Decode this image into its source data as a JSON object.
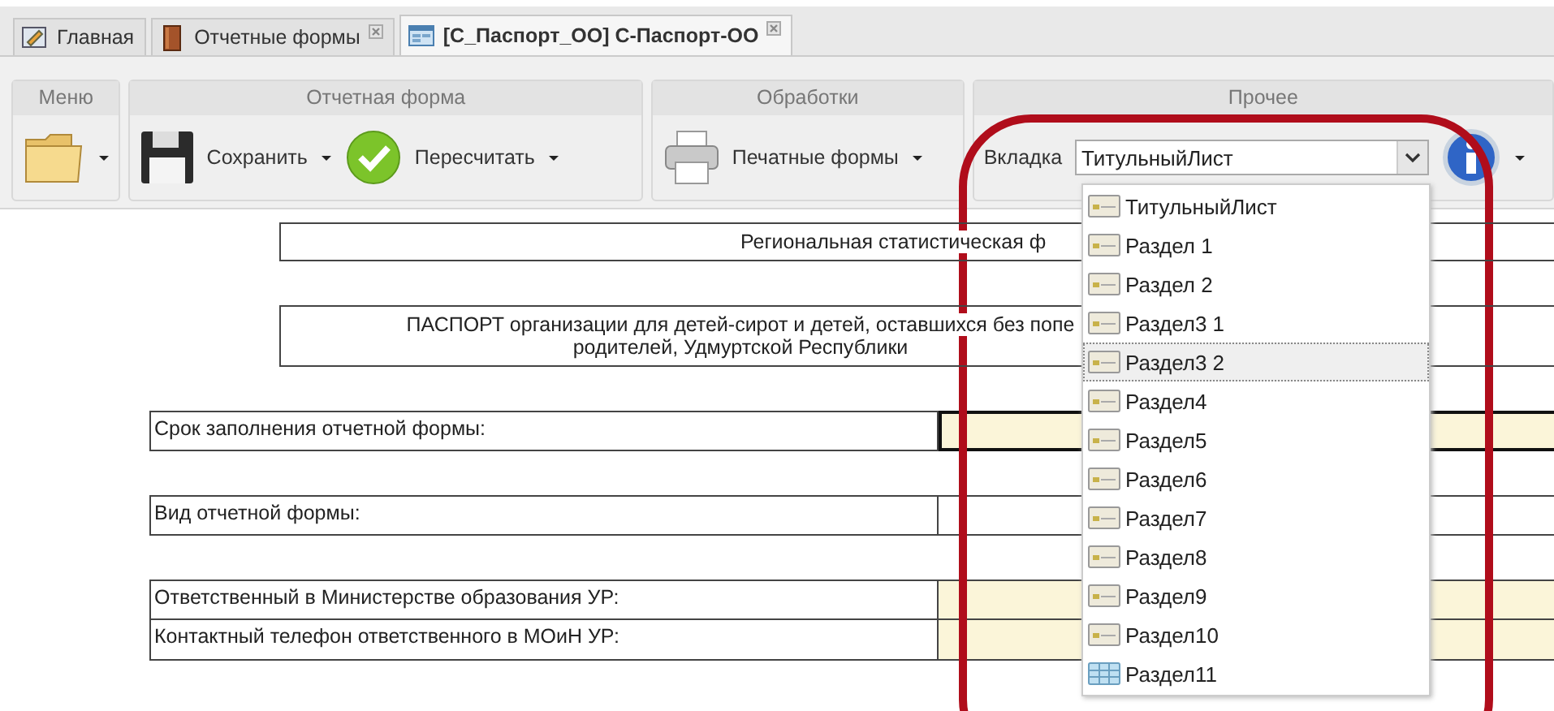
{
  "tabs": [
    {
      "label": "Главная",
      "kind": "home",
      "closable": false,
      "selected": false
    },
    {
      "label": "Отчетные формы",
      "kind": "forms",
      "closable": true,
      "selected": false
    },
    {
      "label": "[С_Паспорт_ОО] С-Паспорт-ОО",
      "kind": "document",
      "closable": true,
      "selected": true
    }
  ],
  "toolbar": [
    {
      "title": "Меню",
      "items": [
        {
          "kind": "folder"
        }
      ]
    },
    {
      "title": "Отчетная форма",
      "items": [
        {
          "kind": "save",
          "label": "Сохранить"
        },
        {
          "kind": "recalc",
          "label": "Пересчитать"
        }
      ]
    },
    {
      "title": "Обработки",
      "items": [
        {
          "kind": "print",
          "label": "Печатные формы"
        }
      ]
    },
    {
      "title": "Прочее",
      "items": [
        {
          "kind": "combo",
          "label": "Вкладка",
          "value": "ТитульныйЛист"
        },
        {
          "kind": "info"
        }
      ]
    }
  ],
  "dropdown": [
    {
      "label": "ТитульныйЛист",
      "kind": "sheet",
      "selected": false
    },
    {
      "label": "Раздел 1",
      "kind": "sheet",
      "selected": false
    },
    {
      "label": "Раздел 2",
      "kind": "sheet",
      "selected": false
    },
    {
      "label": "Раздел3 1",
      "kind": "sheet",
      "selected": false
    },
    {
      "label": "Раздел3 2",
      "kind": "sheet",
      "selected": true
    },
    {
      "label": "Раздел4",
      "kind": "sheet",
      "selected": false
    },
    {
      "label": "Раздел5",
      "kind": "sheet",
      "selected": false
    },
    {
      "label": "Раздел6",
      "kind": "sheet",
      "selected": false
    },
    {
      "label": "Раздел7",
      "kind": "sheet",
      "selected": false
    },
    {
      "label": "Раздел8",
      "kind": "sheet",
      "selected": false
    },
    {
      "label": "Раздел9",
      "kind": "sheet",
      "selected": false
    },
    {
      "label": "Раздел10",
      "kind": "sheet",
      "selected": false
    },
    {
      "label": "Раздел11",
      "kind": "table",
      "selected": false
    }
  ],
  "form": [
    [
      {
        "kind": "title",
        "lines": [
          "Региональная статистическая ф"
        ]
      }
    ],
    [
      {
        "kind": "title",
        "lines": [
          "ПАСПОРТ организации для детей-сирот и детей, оставшихся без попе",
          "родителей, Удмуртской Республики"
        ]
      }
    ],
    [
      {
        "kind": "field",
        "label": "Срок заполнения отчетной формы:",
        "shaded": true,
        "focused": true
      }
    ],
    [
      {
        "kind": "field",
        "label": "Вид отчетной формы:",
        "shaded": false,
        "focused": false
      }
    ],
    [
      {
        "kind": "field",
        "label": "Ответственный в Министерстве образования УР:",
        "shaded": true,
        "focused": false
      },
      {
        "kind": "field",
        "label": "Контактный телефон ответственного в МОиН УР:",
        "shaded": true,
        "focused": false
      }
    ]
  ]
}
